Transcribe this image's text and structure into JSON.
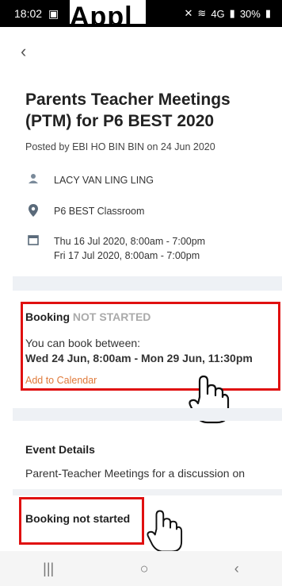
{
  "status_bar": {
    "time": "18:02",
    "overlay_text": "Appl",
    "battery": "30%",
    "network": "4G"
  },
  "header": {
    "back_glyph": "‹"
  },
  "event": {
    "title": "Parents Teacher Meetings (PTM) for P6 BEST 2020",
    "posted_by": "Posted by EBI HO BIN BIN on 24 Jun 2020",
    "teacher": "LACY VAN LING LING",
    "location": "P6 BEST Classroom",
    "dates": [
      "Thu 16 Jul 2020, 8:00am - 7:00pm",
      "Fri 17 Jul 2020, 8:00am - 7:00pm"
    ]
  },
  "booking": {
    "label": "Booking",
    "status": "NOT STARTED",
    "intro": "You can book between:",
    "range": "Wed 24 Jun, 8:00am - Mon 29 Jun, 11:30pm",
    "add_calendar": "Add to Calendar"
  },
  "details": {
    "heading": "Event Details",
    "text": "Parent-Teacher Meetings for a discussion on"
  },
  "footer": {
    "booking_button": "Booking not started"
  },
  "nav": {
    "recent": "|||",
    "home": "○",
    "back": "‹"
  },
  "colors": {
    "highlight": "#e01010",
    "accent": "#e07a3a",
    "status_muted": "#aaaaaa"
  }
}
